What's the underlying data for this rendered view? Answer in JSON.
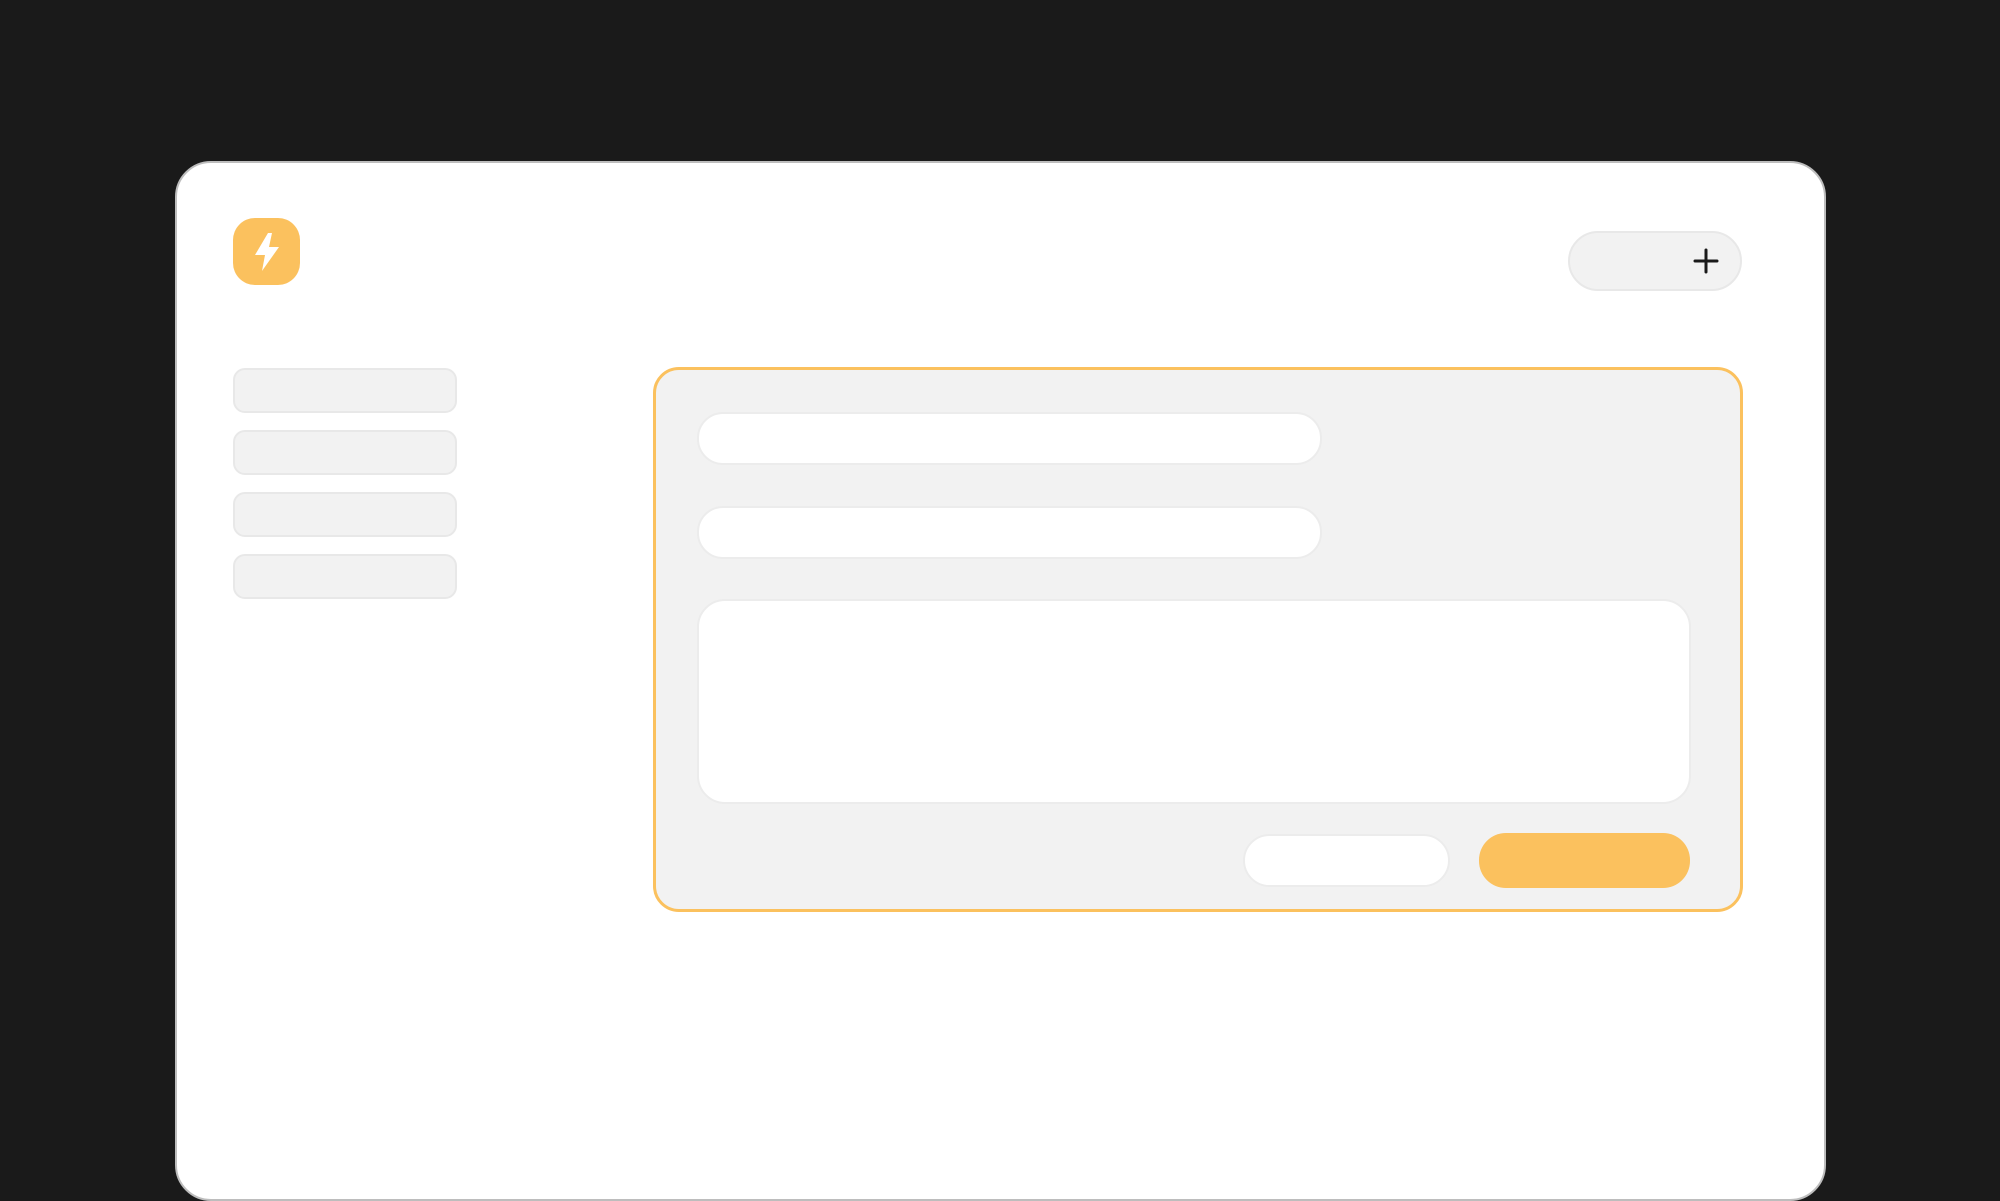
{
  "colors": {
    "background": "#1a1a1a",
    "accent": "#fbc15e",
    "panel": "#f2f2f2",
    "field": "#ffffff"
  },
  "header": {
    "logo_icon": "lightning-bolt-icon",
    "add_button_icon": "plus-icon",
    "add_button_label": ""
  },
  "sidebar": {
    "items": [
      {
        "label": ""
      },
      {
        "label": ""
      },
      {
        "label": ""
      },
      {
        "label": ""
      }
    ]
  },
  "form": {
    "field_1": {
      "value": "",
      "placeholder": ""
    },
    "field_2": {
      "value": "",
      "placeholder": ""
    },
    "textarea": {
      "value": "",
      "placeholder": ""
    },
    "cancel_label": "",
    "submit_label": ""
  }
}
